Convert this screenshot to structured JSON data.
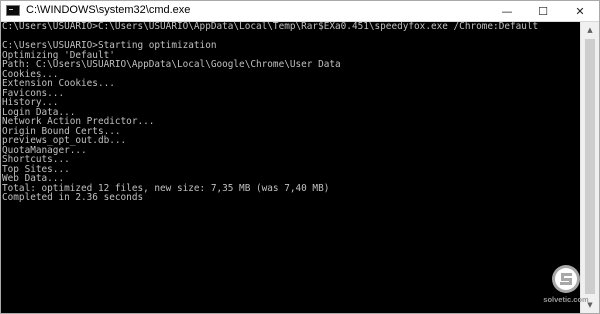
{
  "window": {
    "title": "C:\\WINDOWS\\system32\\cmd.exe",
    "controls": {
      "minimize": "—",
      "maximize": "☐",
      "close": "✕"
    }
  },
  "console": {
    "lines": [
      "C:\\Users\\USUARIO>C:\\Users\\USUARIO\\AppData\\Local\\Temp\\Rar$EXa0.451\\speedyfox.exe /Chrome:Default",
      "",
      "C:\\Users\\USUARIO>Starting optimization",
      "Optimizing 'Default'",
      "Path: C:\\Users\\USUARIO\\AppData\\Local\\Google\\Chrome\\User Data",
      "Cookies...",
      "Extension Cookies...",
      "Favicons...",
      "History...",
      "Login Data...",
      "Network Action Predictor...",
      "Origin Bound Certs...",
      "previews_opt_out.db...",
      "QuotaManager...",
      "Shortcuts...",
      "Top Sites...",
      "Web Data...",
      "Total: optimized 12 files, new size: 7,35 MB (was 7,40 MB)",
      "Completed in 2.36 seconds"
    ]
  },
  "scrollbar": {
    "up_arrow": "▲",
    "down_arrow": "▼"
  },
  "watermark": {
    "text": "solvetic.com",
    "icon": "solvetic-logo-icon"
  },
  "colors": {
    "console_bg": "#000000",
    "console_text": "#c0c0c0",
    "titlebar_bg": "#ffffff"
  }
}
